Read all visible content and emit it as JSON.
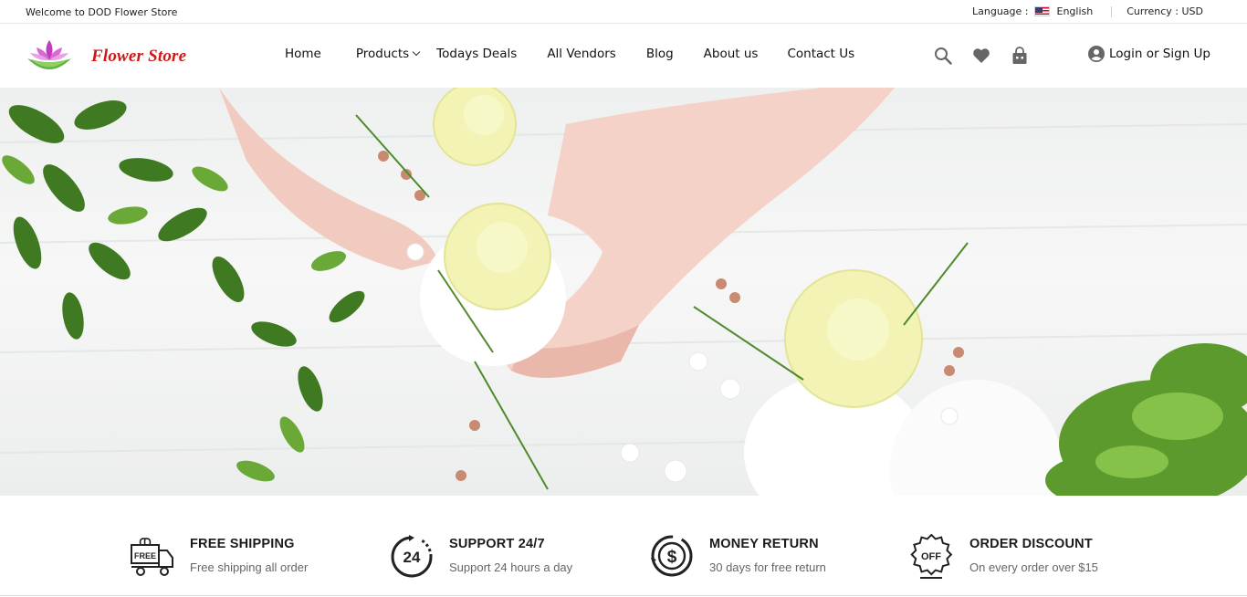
{
  "topbar": {
    "welcome": "Welcome to DOD Flower Store",
    "language_label": "Language :",
    "language_value": "English",
    "currency": "Currency : USD"
  },
  "header": {
    "brand": "Flower Store",
    "nav": [
      {
        "label": "Home"
      },
      {
        "label": "Products"
      },
      {
        "label": "Todays Deals"
      },
      {
        "label": "All Vendors"
      },
      {
        "label": "Blog"
      },
      {
        "label": "About us"
      },
      {
        "label": "Contact Us"
      }
    ],
    "icons": [
      "search-icon",
      "heart-icon",
      "shopping-bag-icon"
    ],
    "login_label": "Login or Sign Up"
  },
  "features": [
    {
      "title": "FREE SHIPPING",
      "subtitle": "Free shipping all order",
      "icon": "free-truck-icon",
      "icon_text": "FREE"
    },
    {
      "title": "SUPPORT 24/7",
      "subtitle": "Support 24 hours a day",
      "icon": "support-24-icon",
      "icon_text": "24"
    },
    {
      "title": "MONEY RETURN",
      "subtitle": "30 days for free return",
      "icon": "money-return-icon",
      "icon_text": "$"
    },
    {
      "title": "ORDER DISCOUNT",
      "subtitle": "On every order over $15",
      "icon": "discount-badge-icon",
      "icon_text": "OFF"
    }
  ],
  "colors": {
    "brand": "#d01818",
    "text": "#111111",
    "muted": "#666666",
    "icon_gray": "#666666"
  }
}
